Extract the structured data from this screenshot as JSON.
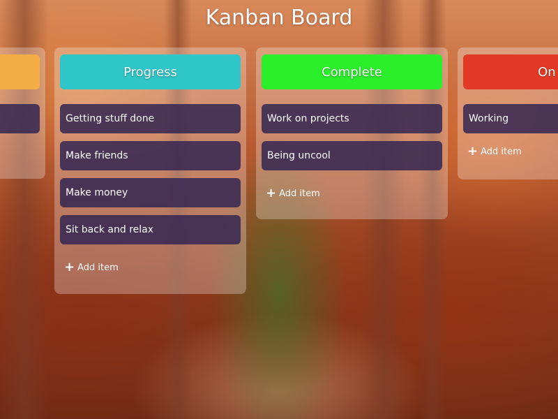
{
  "board": {
    "title": "Kanban Board"
  },
  "columns": [
    {
      "header": "",
      "header_color": "#F5AE45",
      "items": [
        ""
      ],
      "add_label": ""
    },
    {
      "header": "Progress",
      "header_color": "#2EC6C8",
      "items": [
        "Getting stuff done",
        "Make friends",
        "Make money",
        "Sit back and relax"
      ],
      "add_label": "Add item"
    },
    {
      "header": "Complete",
      "header_color": "#2BEF2B",
      "items": [
        "Work on projects",
        "Being uncool"
      ],
      "add_label": "Add item"
    },
    {
      "header": "On H",
      "header_color": "#E23A26",
      "items": [
        "Working"
      ],
      "add_label": "Add item"
    }
  ],
  "icons": {
    "add": "plus-icon"
  }
}
